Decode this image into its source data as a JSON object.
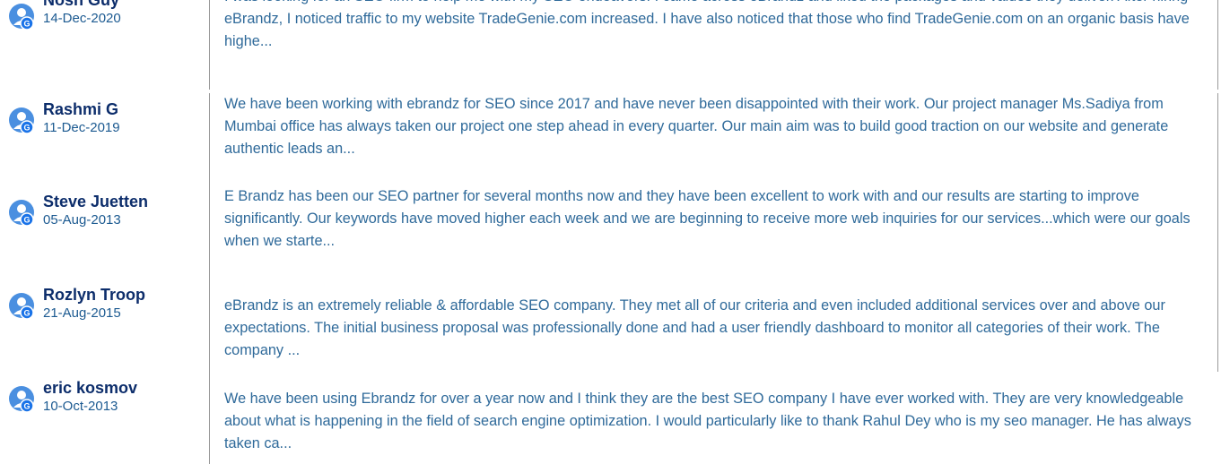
{
  "reviews": [
    {
      "name": "Nosh Guy",
      "date": "14-Dec-2020",
      "text": "I was looking for an SEO firm to help me with my SEO endeavors. I came across eBrandz and liked the packages and values they deliver. After hiring eBrandz, I noticed traffic to my website TradeGenie.com increased. I have also noticed that those who find TradeGenie.com on an organic basis have highe...",
      "avatar_icon": "google-reviewer-avatar-icon"
    },
    {
      "name": "Rashmi G",
      "date": "11-Dec-2019",
      "text": "We have been working with ebrandz for SEO since 2017 and have never been disappointed with their work. Our project manager Ms.Sadiya from Mumbai office has always taken our project one step ahead in every quarter. Our main aim was to build good traction on our website and generate authentic leads an...",
      "avatar_icon": "google-reviewer-avatar-icon"
    },
    {
      "name": "Steve Juetten",
      "date": "05-Aug-2013",
      "text": "E Brandz has been our SEO partner for several months now and they have been excellent to work with and our results are starting to improve significantly. Our keywords have moved higher each week and we are beginning to receive more web inquiries for our services...which were our goals when we starte...",
      "avatar_icon": "google-reviewer-avatar-icon"
    },
    {
      "name": "Rozlyn Troop",
      "date": "21-Aug-2015",
      "text": "eBrandz is an extremely reliable & affordable SEO company. They met all of our criteria and even included additional services over and above our expectations. The initial business proposal was professionally done and had a user friendly dashboard to monitor all categories of their work. The company ...",
      "avatar_icon": "google-reviewer-avatar-icon"
    },
    {
      "name": "eric kosmov",
      "date": "10-Oct-2013",
      "text": "We have been using Ebrandz for over a year now and I think they are the best SEO company I have ever worked with. They are very knowledgeable about what is happening in the field of search engine optimization. I would particularly like to thank Rahul Dey who is my seo manager. He has always taken ca...",
      "avatar_icon": "google-reviewer-avatar-icon"
    }
  ],
  "colors": {
    "name": "#0c2d6b",
    "date": "#1c5a91",
    "text": "#2f6a9a",
    "avatar_blue": "#4a8fe0",
    "avatar_badge": "#1a73e8",
    "divider": "#9a9a9a"
  }
}
